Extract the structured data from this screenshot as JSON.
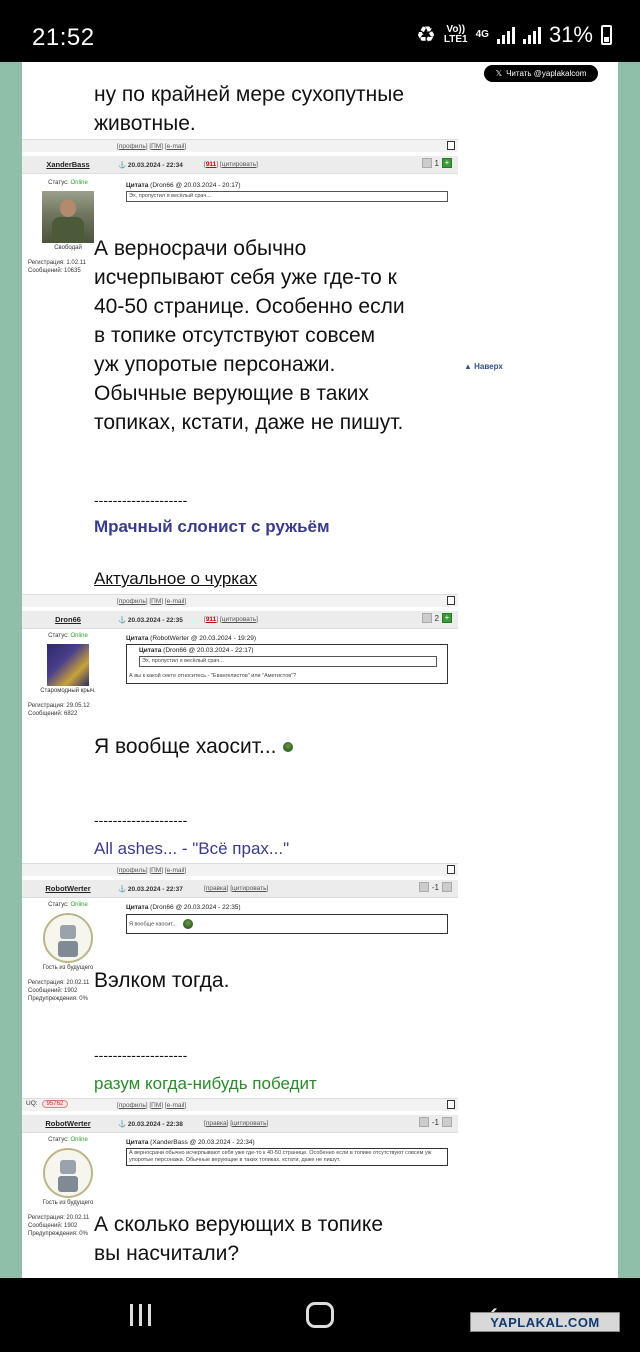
{
  "status_bar": {
    "time": "21:52",
    "network_top": "Vo))",
    "network_bottom": "LTE1",
    "net_gen": "4G",
    "battery": "31%"
  },
  "side": {
    "x_button": "Читать @yaplakalcom",
    "naverh": "▲ Наверх"
  },
  "post0": {
    "text_lines": [
      "ну по крайней мере сухопутные",
      "животные."
    ]
  },
  "links": {
    "profile": "профиль",
    "pm": "ПМ",
    "email": "e-mail"
  },
  "post1": {
    "user": "XanderBass",
    "status_label": "Статус:",
    "status_value": "Online",
    "avatar_caption": "Свободай",
    "reg": "Регистрация: 1.02.11",
    "msgs": "Сообщений: 10635",
    "date": "20.03.2024 - 22:34",
    "num": "911",
    "cite": "цитировать",
    "rating": "1",
    "quote_label": "Цитата",
    "quote_src": "(Dron66 @ 20.03.2024 - 20:17)",
    "quote_text": "Эх, пропустил я весёлый срач...",
    "text_lines": [
      "А верносрачи обычно",
      "исчерпывают себя уже где-то к",
      "40-50 странице. Особенно если",
      "в топике отсутствуют совсем",
      "уж упоротые персонажи.",
      "Обычные верующие в таких",
      "топиках, кстати, даже не пишут."
    ],
    "separator": "--------------------",
    "sig1": "Мрачный слонист с ружьём",
    "sig2": "Актуальное о чурках"
  },
  "post2": {
    "user": "Dron66",
    "status_label": "Статус:",
    "status_value": "Online",
    "avatar_caption": "Старомодный крыч.",
    "reg": "Регистрация: 29.05.12",
    "msgs": "Сообщений: 6822",
    "date": "20.03.2024 - 22:35",
    "num": "911",
    "cite": "цитировать",
    "rating": "2",
    "quote_label": "Цитата",
    "quote_src": "(RobotWerter @ 20.03.2024 - 19:29)",
    "inner_label": "Цитата",
    "inner_src": "(Dron66 @ 20.03.2024 - 22:17)",
    "inner_text": "Эх, пропустил я весёлый срач...",
    "quote_text": "А вы к какой секте относитесь - \"Евангелистов\" или \"Аметистов\"?",
    "text": "Я вообще хаосит...",
    "separator": "--------------------",
    "sig": "All ashes... - \"Всё прах...\""
  },
  "post3": {
    "user": "RobotWerter",
    "status_label": "Статус:",
    "status_value": "Online",
    "avatar_caption": "Гость из будущего",
    "reg": "Регистрация: 20.02.11",
    "msgs": "Сообщений: 1902",
    "warn": "Предупреждения: 0%",
    "date": "20.03.2024 - 22:37",
    "edit": "правка",
    "cite": "цитировать",
    "rating": "-1",
    "quote_label": "Цитата",
    "quote_src": "(Dron66 @ 20.03.2024 - 22:35)",
    "quote_text": "Я вообще хаосит...",
    "text": "Вэлком тогда.",
    "separator": "--------------------",
    "sig": "разум когда-нибудь победит"
  },
  "post4": {
    "uq_label": "UQ:",
    "uq_value": "95762",
    "user": "RobotWerter",
    "status_label": "Статус:",
    "status_value": "Online",
    "avatar_caption": "Гость из будущего",
    "reg": "Регистрация: 20.02.11",
    "msgs": "Сообщений: 1902",
    "warn": "Предупреждения: 0%",
    "date": "20.03.2024 - 22:38",
    "edit": "правка",
    "cite": "цитировать",
    "rating": "-1",
    "quote_label": "Цитата",
    "quote_src": "(XanderBass @ 20.03.2024 - 22:34)",
    "quote_text": "А верносрачи обычно исчерпывают себя уже где-то к 40-50 странице. Особенно если в топике отсутствуют совсем уж упоротые персонажи. Обычные верующие в таких топиках, кстати, даже не пишут.",
    "text_lines": [
      "А сколько верующих в топике",
      "вы насчитали?"
    ]
  },
  "nav": {
    "watermark": "YAPLAKAL.COM"
  }
}
